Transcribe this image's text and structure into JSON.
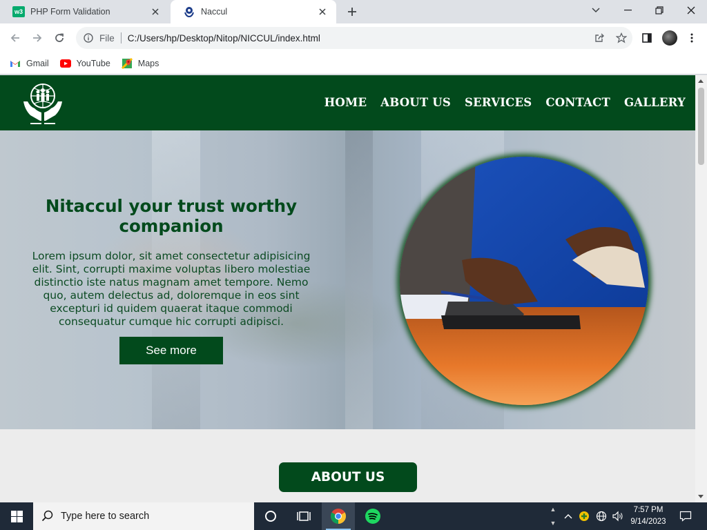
{
  "browser": {
    "tabs": [
      {
        "title": "PHP Form Validation",
        "favicon": "w3schools-icon",
        "active": false
      },
      {
        "title": "Naccul",
        "favicon": "naccul-logo-icon",
        "active": true
      }
    ],
    "address": {
      "scheme": "File",
      "url": "C:/Users/hp/Desktop/Nitop/NICCUL/index.html"
    },
    "bookmarks": [
      {
        "label": "Gmail",
        "icon": "gmail-icon"
      },
      {
        "label": "YouTube",
        "icon": "youtube-icon"
      },
      {
        "label": "Maps",
        "icon": "maps-icon"
      }
    ]
  },
  "site": {
    "nav": [
      "HOME",
      "ABOUT US",
      "SERVICES",
      "CONTACT",
      "GALLERY"
    ],
    "hero": {
      "title": "Nitaccul your trust worthy companion",
      "body": "Lorem ipsum dolor, sit amet consectetur adipisicing elit. Sint, corrupti maxime voluptas libero molestiae distinctio iste natus magnam amet tempore. Nemo quo, autem delectus ad, doloremque in eos sint excepturi id quidem quaerat itaque commodi consequatur cumque hic corrupti adipisci.",
      "cta": "See more"
    },
    "about_button": "ABOUT US"
  },
  "taskbar": {
    "search_placeholder": "Type here to search",
    "time": "7:57 PM",
    "date": "9/14/2023"
  },
  "colors": {
    "brand_green": "#024a1c",
    "tab_strip": "#dee1e6",
    "taskbar": "#1f2a38"
  }
}
